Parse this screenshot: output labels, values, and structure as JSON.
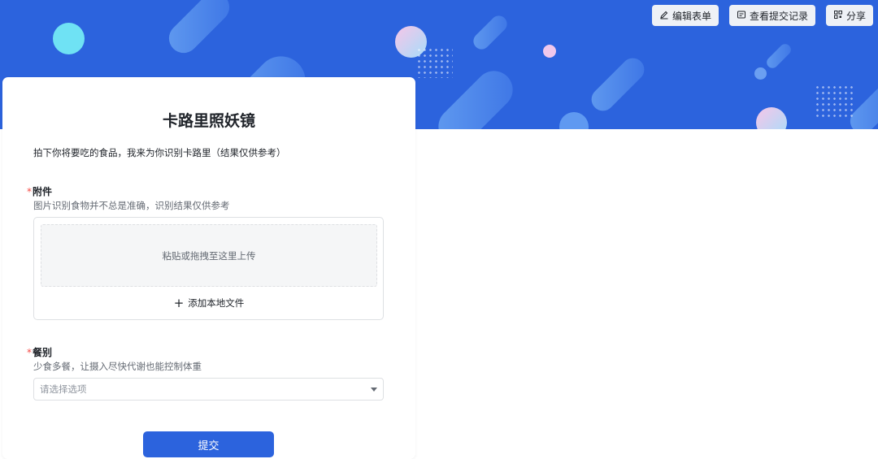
{
  "header_actions": [
    {
      "label": "编辑表单",
      "icon": "edit-icon"
    },
    {
      "label": "查看提交记录",
      "icon": "records-icon"
    },
    {
      "label": "分享",
      "icon": "qr-share-icon"
    }
  ],
  "form": {
    "title": "卡路里照妖镜",
    "description": "拍下你将要吃的食品，我来为你识别卡路里（结果仅供参考）",
    "required_mark": "*",
    "attachment": {
      "label": "附件",
      "hint": "图片识别食物并不总是准确，识别结果仅供参考",
      "drop_text": "粘贴或拖拽至这里上传",
      "add_file_label": "添加本地文件"
    },
    "meal": {
      "label": "餐别",
      "hint": "少食多餐，让摄入尽快代谢也能控制体重",
      "placeholder": "请选择选项"
    },
    "submit_label": "提交"
  },
  "colors": {
    "banner": "#2c63dd",
    "primary": "#2c63dd",
    "required": "#f54a45"
  }
}
